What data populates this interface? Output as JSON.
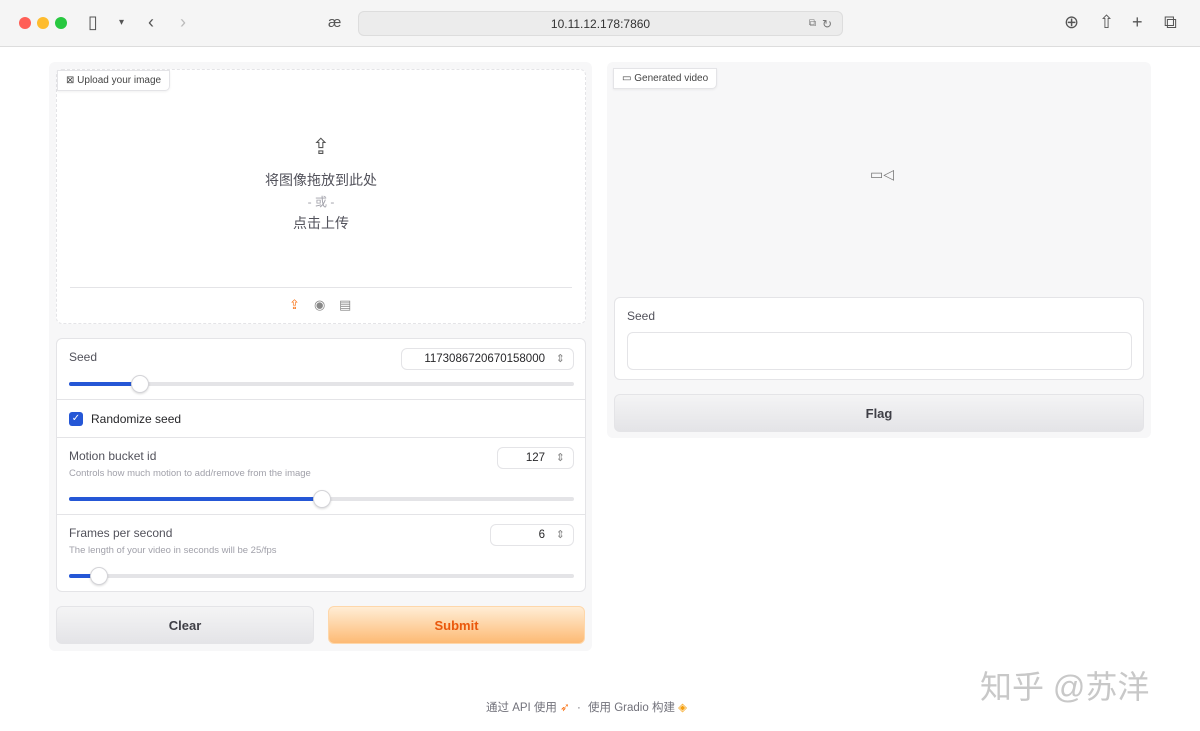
{
  "browser": {
    "url": "10.11.12.178:7860",
    "reader_icon": "æ"
  },
  "upload": {
    "label": "Upload your image",
    "drop_text": "将图像拖放到此处",
    "or_text": "- 或 -",
    "click_text": "点击上传"
  },
  "video": {
    "label": "Generated video"
  },
  "seed": {
    "label": "Seed",
    "value": "1173086720670158000",
    "slider_fraction": 0.14
  },
  "randomize": {
    "label": "Randomize seed",
    "checked": true
  },
  "motion": {
    "label": "Motion bucket id",
    "info": "Controls how much motion to add/remove from the image",
    "value": "127",
    "slider_fraction": 0.5
  },
  "fps": {
    "label": "Frames per second",
    "info": "The length of your video in seconds will be 25/fps",
    "value": "6",
    "slider_fraction": 0.06
  },
  "buttons": {
    "clear": "Clear",
    "submit": "Submit",
    "flag": "Flag"
  },
  "output_seed": {
    "label": "Seed",
    "value": ""
  },
  "footer": {
    "api": "通过 API 使用",
    "sep": "·",
    "built": "使用 Gradio 构建"
  },
  "watermark": "知乎 @苏洋",
  "colors": {
    "accent": "#2557d6",
    "submit_text": "#ea580c"
  }
}
